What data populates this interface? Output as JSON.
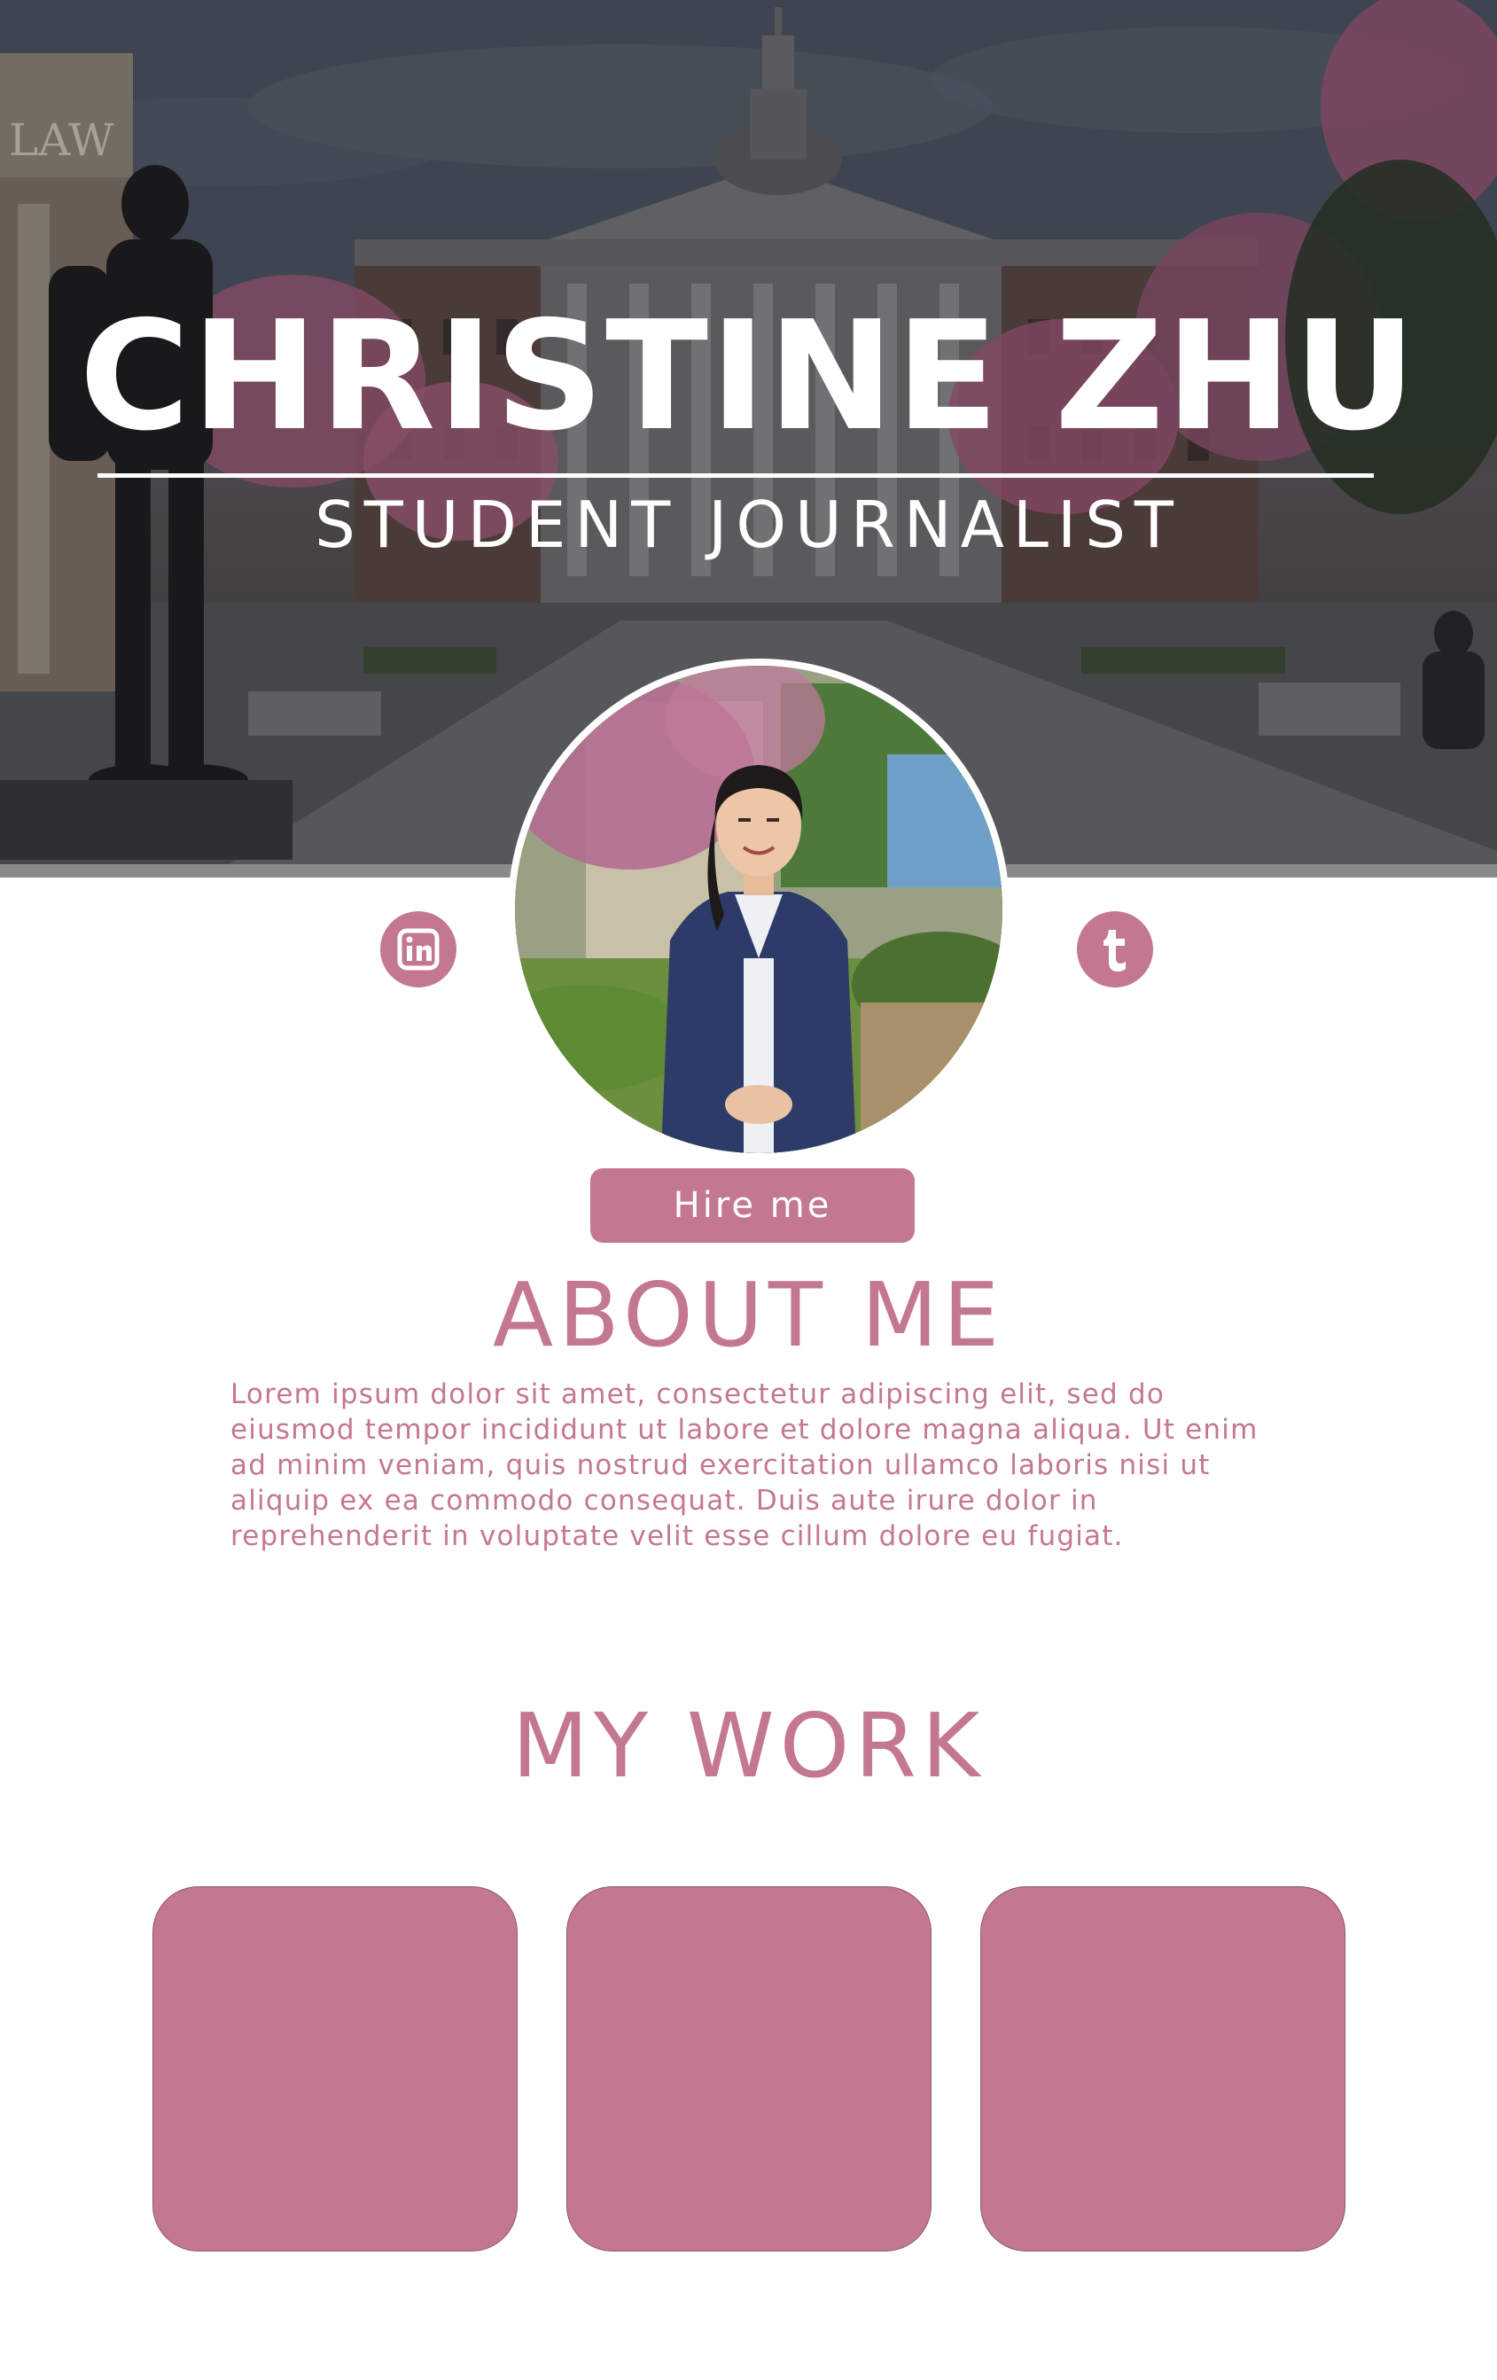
{
  "hero": {
    "name": "CHRISTINE ZHU",
    "subtitle": "STUDENT JOURNALIST",
    "background_sign": "LAW"
  },
  "profile": {
    "photo": "portrait-photo",
    "social": [
      {
        "name": "linkedin",
        "icon": "linkedin-icon"
      },
      {
        "name": "tumblr",
        "icon": "tumblr-icon"
      }
    ],
    "hire_button": "Hire me"
  },
  "about": {
    "heading": "ABOUT ME",
    "lines": [
      "Lorem ipsum dolor sit amet, consectetur adipiscing elit, sed do",
      "eiusmod tempor incididunt ut labore et dolore magna aliqua. Ut enim",
      "ad minim veniam, quis nostrud exercitation ullamco laboris nisi ut",
      "aliquip ex ea commodo consequat. Duis aute irure dolor in",
      "reprehenderit in voluptate velit esse cillum dolore eu fugiat."
    ]
  },
  "work": {
    "heading": "MY WORK",
    "cards": 3
  },
  "colors": {
    "accent": "#c4788f",
    "background": "#ffffff",
    "hero_text": "#ffffff"
  }
}
